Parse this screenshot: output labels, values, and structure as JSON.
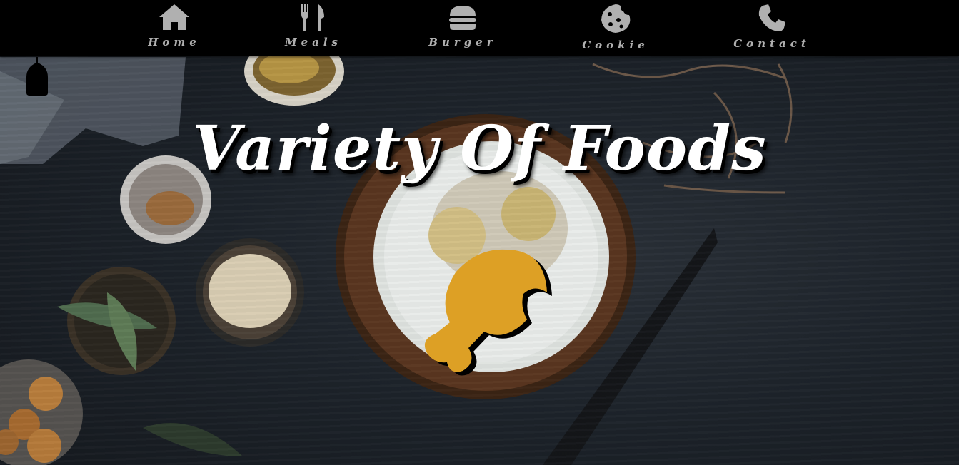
{
  "nav": {
    "items": [
      {
        "label": "Home",
        "icon": "home-icon"
      },
      {
        "label": "Meals",
        "icon": "utensils-icon"
      },
      {
        "label": "Burger",
        "icon": "burger-icon"
      },
      {
        "label": "Cookie",
        "icon": "cookie-icon"
      },
      {
        "label": "Contact",
        "icon": "phone-icon"
      }
    ]
  },
  "hero": {
    "title": "Variety Of Foods",
    "logo_icon": "drumstick-icon"
  },
  "colors": {
    "nav_bg": "#000000",
    "nav_text": "#b0b0b0",
    "accent": "#DDA025",
    "title": "#ffffff"
  }
}
